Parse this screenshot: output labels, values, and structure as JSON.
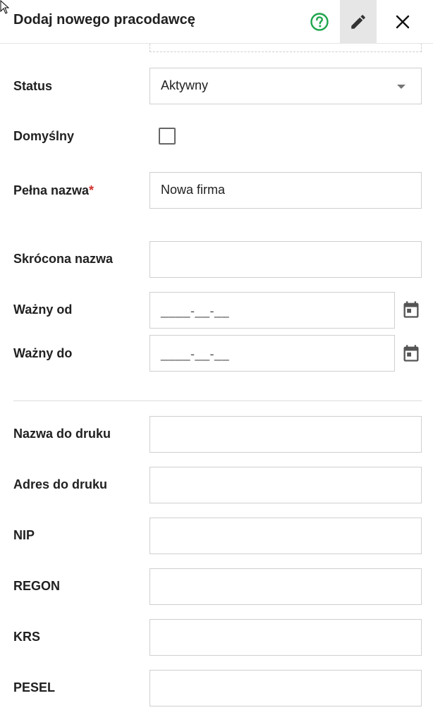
{
  "header": {
    "title": "Dodaj nowego pracodawcę",
    "help_color": "#1ea54c"
  },
  "form": {
    "status": {
      "label": "Status",
      "value": "Aktywny"
    },
    "default": {
      "label": "Domyślny",
      "checked": false
    },
    "full_name": {
      "label": "Pełna nazwa",
      "required_mark": "*",
      "value": "Nowa firma"
    },
    "short_name": {
      "label": "Skrócona nazwa",
      "value": ""
    },
    "valid_from": {
      "label": "Ważny od",
      "mask": "____-__-__"
    },
    "valid_to": {
      "label": "Ważny do",
      "mask": "____-__-__"
    },
    "print_name": {
      "label": "Nazwa do druku",
      "value": ""
    },
    "print_address": {
      "label": "Adres do druku",
      "value": ""
    },
    "nip": {
      "label": "NIP",
      "value": ""
    },
    "regon": {
      "label": "REGON",
      "value": ""
    },
    "krs": {
      "label": "KRS",
      "value": ""
    },
    "pesel": {
      "label": "PESEL",
      "value": ""
    }
  },
  "icons": {
    "help": "help-circle-icon",
    "edit": "pencil-icon",
    "close": "close-icon",
    "calendar": "calendar-icon",
    "dropdown": "chevron-down-icon"
  }
}
